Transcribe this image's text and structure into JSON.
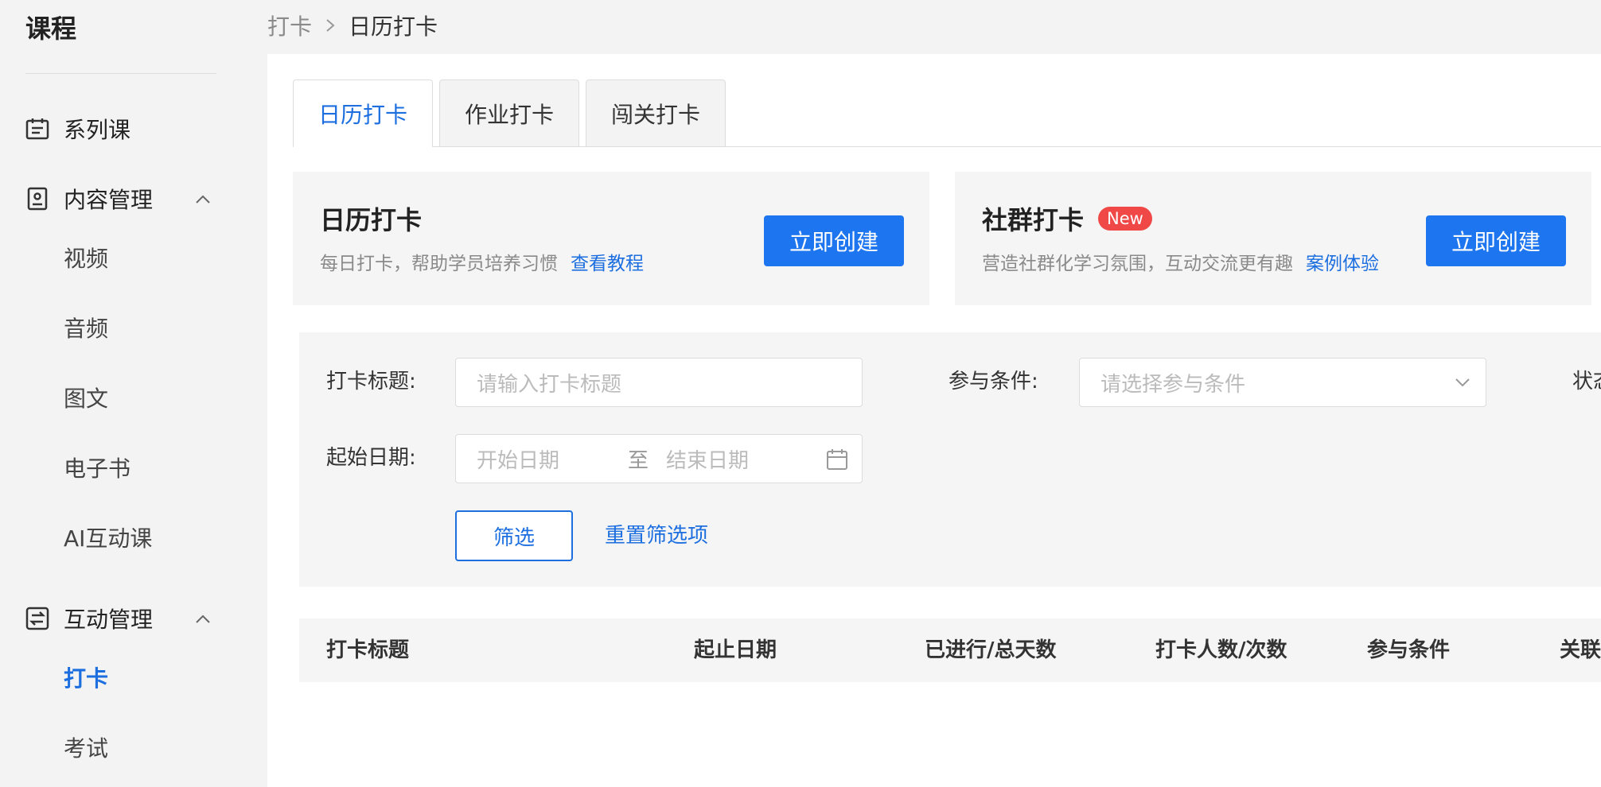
{
  "sidebar": {
    "title": "课程",
    "series": {
      "label": "系列课",
      "icon": "calendar-list-icon"
    },
    "content_group": {
      "label": "内容管理",
      "icon": "content-doc-icon",
      "items": [
        "视频",
        "音频",
        "图文",
        "电子书",
        "AI互动课"
      ]
    },
    "interact_group": {
      "label": "互动管理",
      "icon": "interaction-swap-icon",
      "items": [
        "打卡",
        "考试"
      ],
      "active": "打卡"
    }
  },
  "breadcrumb": {
    "parent": "打卡",
    "current": "日历打卡"
  },
  "tabs": [
    "日历打卡",
    "作业打卡",
    "闯关打卡"
  ],
  "cards": {
    "calendar": {
      "title": "日历打卡",
      "desc": "每日打卡，帮助学员培养习惯",
      "link": "查看教程",
      "button": "立即创建"
    },
    "community": {
      "title": "社群打卡",
      "badge": "New",
      "desc": "营造社群化学习氛围，互动交流更有趣",
      "link": "案例体验",
      "button": "立即创建"
    }
  },
  "filters": {
    "title_label": "打卡标题:",
    "title_placeholder": "请输入打卡标题",
    "condition_label": "参与条件:",
    "condition_placeholder": "请选择参与条件",
    "status_label": "状态",
    "date_label": "起始日期:",
    "date_start_placeholder": "开始日期",
    "date_sep": "至",
    "date_end_placeholder": "结束日期",
    "filter_button": "筛选",
    "reset_link": "重置筛选项"
  },
  "table": {
    "headers": [
      "打卡标题",
      "起止日期",
      "已进行/总天数",
      "打卡人数/次数",
      "参与条件",
      "关联"
    ]
  },
  "colors": {
    "accent": "#1d6fe0",
    "badge": "#f04747"
  }
}
